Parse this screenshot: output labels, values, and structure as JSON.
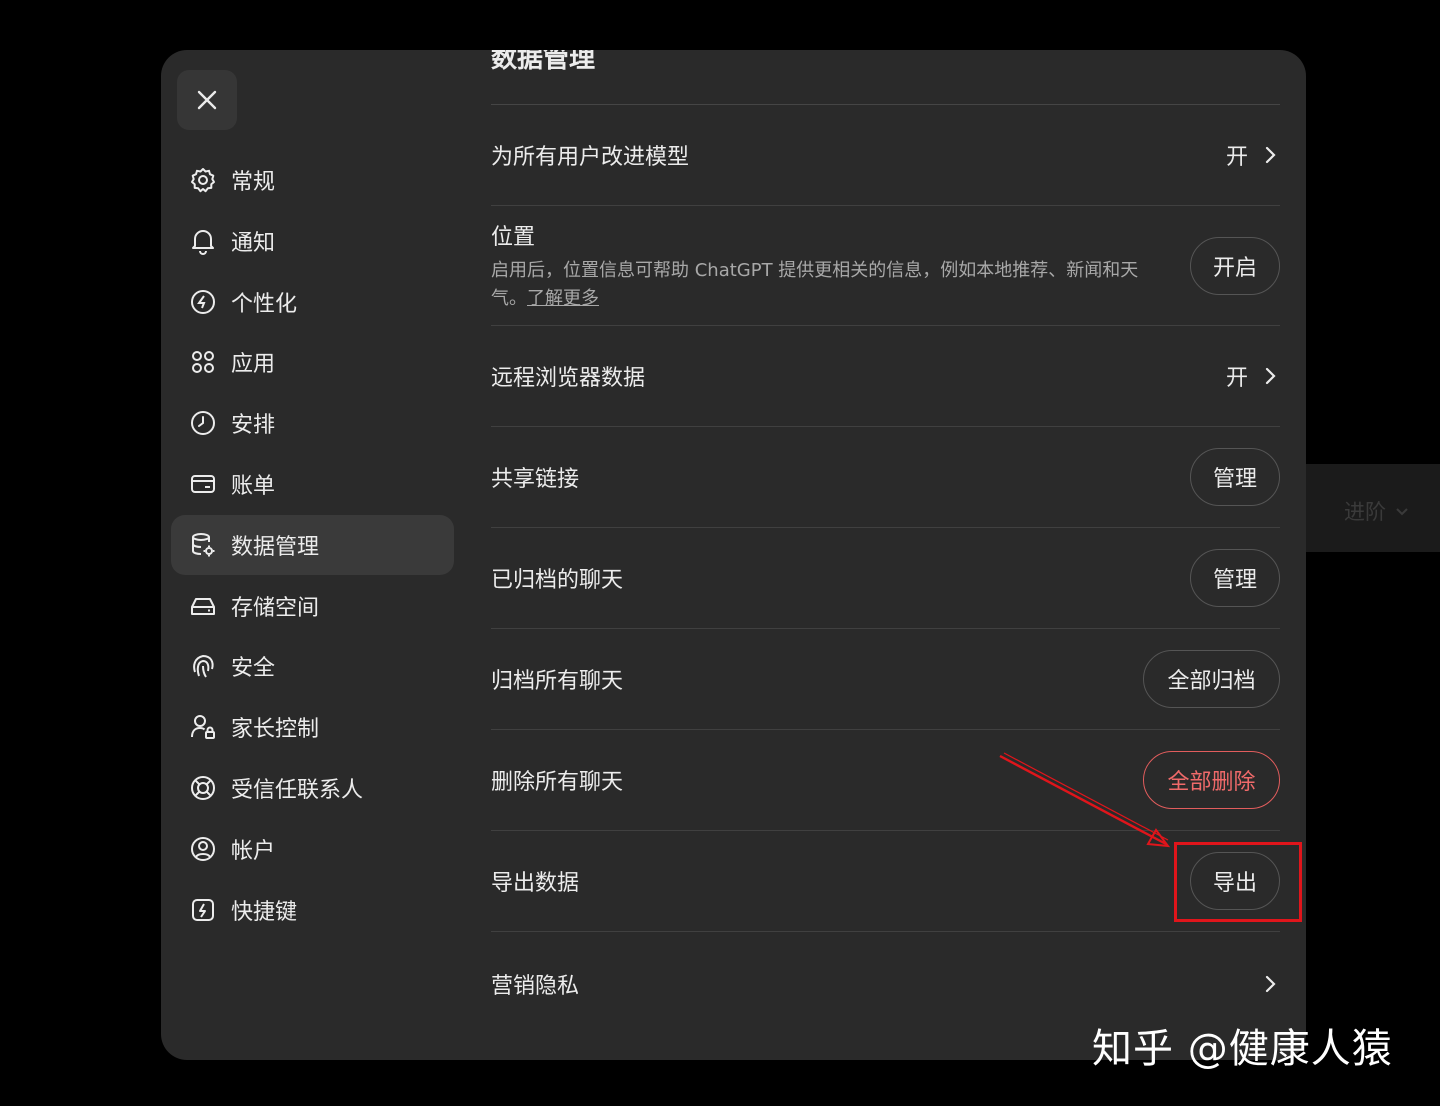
{
  "background_panel": {
    "label": "进阶"
  },
  "sidebar": {
    "items": [
      {
        "label": "常规",
        "icon": "gear-icon"
      },
      {
        "label": "通知",
        "icon": "bell-icon"
      },
      {
        "label": "个性化",
        "icon": "personalize-icon"
      },
      {
        "label": "应用",
        "icon": "apps-grid-icon"
      },
      {
        "label": "安排",
        "icon": "clock-icon"
      },
      {
        "label": "账单",
        "icon": "card-icon"
      },
      {
        "label": "数据管理",
        "icon": "database-gear-icon",
        "active": true
      },
      {
        "label": "存储空间",
        "icon": "storage-icon"
      },
      {
        "label": "安全",
        "icon": "fingerprint-icon"
      },
      {
        "label": "家长控制",
        "icon": "parental-icon"
      },
      {
        "label": "受信任联系人",
        "icon": "lifebuoy-icon"
      },
      {
        "label": "帐户",
        "icon": "account-icon"
      },
      {
        "label": "快捷键",
        "icon": "shortcut-icon"
      }
    ]
  },
  "content": {
    "title": "数据管理",
    "rows": {
      "improve_model": {
        "label": "为所有用户改进模型",
        "value": "开"
      },
      "location": {
        "label": "位置",
        "description": "启用后，位置信息可帮助 ChatGPT 提供更相关的信息，例如本地推荐、新闻和天气。",
        "link": "了解更多",
        "button": "开启"
      },
      "remote_browser": {
        "label": "远程浏览器数据",
        "value": "开"
      },
      "shared_links": {
        "label": "共享链接",
        "button": "管理"
      },
      "archived_chats": {
        "label": "已归档的聊天",
        "button": "管理"
      },
      "archive_all": {
        "label": "归档所有聊天",
        "button": "全部归档"
      },
      "delete_all": {
        "label": "删除所有聊天",
        "button": "全部删除"
      },
      "export": {
        "label": "导出数据",
        "button": "导出"
      },
      "marketing": {
        "label": "营销隐私"
      }
    }
  },
  "annotation": {
    "color": "#e0151b"
  },
  "colors": {
    "danger": "#f06a6a",
    "modal_bg": "#2a2a2a"
  },
  "watermark": "知乎 @健康人猿"
}
